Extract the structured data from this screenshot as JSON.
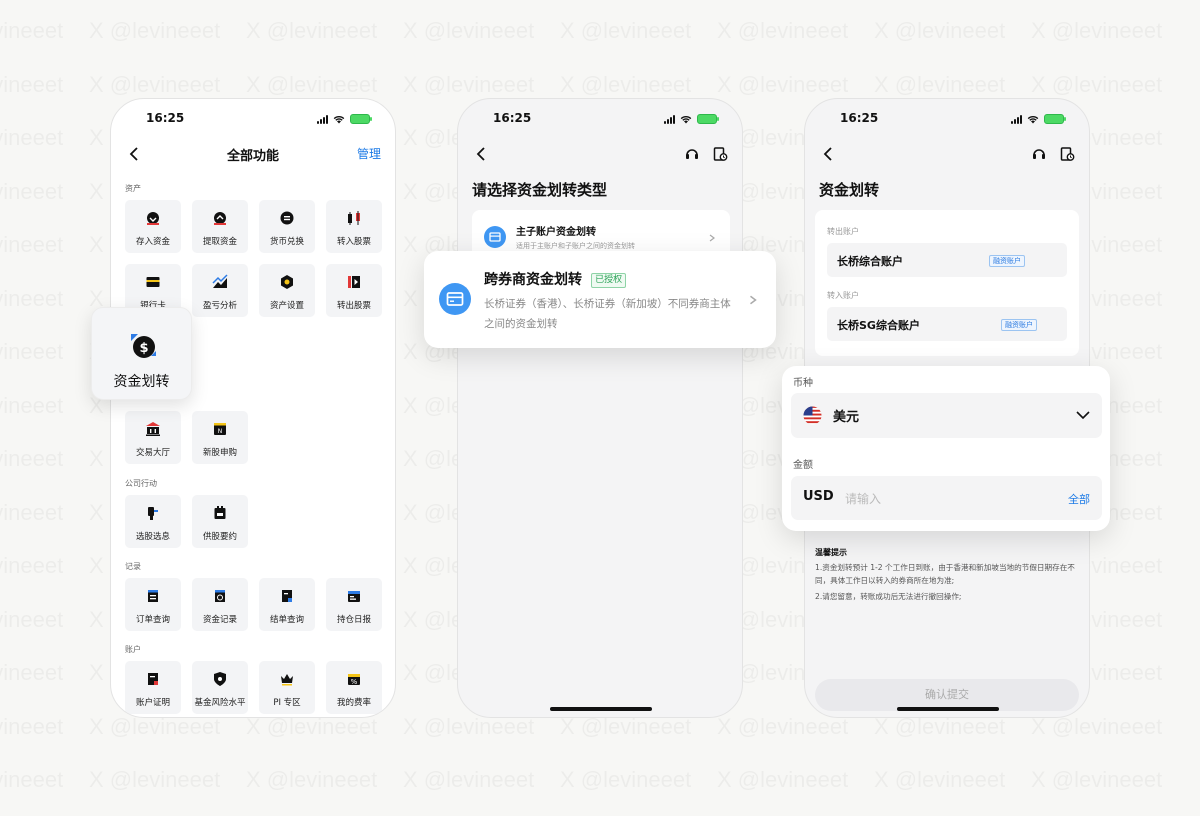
{
  "watermark": "X @levineeet",
  "status": {
    "time": "16:25"
  },
  "screen1": {
    "nav_title": "全部功能",
    "manage": "管理",
    "sections": {
      "assets": "资产",
      "corporate": "公司行动",
      "records": "记录",
      "account": "账户"
    },
    "assets_tiles": [
      {
        "label": "存入资金",
        "icon": "deposit-icon"
      },
      {
        "label": "提取资金",
        "icon": "withdraw-icon"
      },
      {
        "label": "货币兑换",
        "icon": "currency-exchange-icon"
      },
      {
        "label": "转入股票",
        "icon": "stock-in-icon"
      },
      {
        "label": "银行卡",
        "icon": "bank-card-icon"
      },
      {
        "label": "盈亏分析",
        "icon": "chart-icon"
      },
      {
        "label": "资产设置",
        "icon": "settings-icon"
      },
      {
        "label": "转出股票",
        "icon": "stock-out-icon"
      }
    ],
    "highlight_tile": {
      "label": "资金划转",
      "icon": "dollar-transfer-icon"
    },
    "trade_tiles": [
      {
        "label": "交易大厅",
        "icon": "bank-hall-icon"
      },
      {
        "label": "新股申购",
        "icon": "ipo-icon"
      }
    ],
    "corporate_tiles": [
      {
        "label": "选股选息",
        "icon": "option-icon"
      },
      {
        "label": "供股要约",
        "icon": "offer-icon"
      }
    ],
    "record_tiles": [
      {
        "label": "订单查询",
        "icon": "order-icon"
      },
      {
        "label": "资金记录",
        "icon": "fund-record-icon"
      },
      {
        "label": "结单查询",
        "icon": "statement-icon"
      },
      {
        "label": "持仓日报",
        "icon": "daily-report-icon"
      }
    ],
    "account_tiles": [
      {
        "label": "账户证明",
        "icon": "certificate-icon"
      },
      {
        "label": "基金风险水平",
        "icon": "risk-shield-icon"
      },
      {
        "label": "PI 专区",
        "icon": "crown-icon"
      },
      {
        "label": "我的费率",
        "icon": "rate-icon"
      }
    ]
  },
  "screen2": {
    "title": "请选择资金划转类型",
    "option1": {
      "title": "主子账户资金划转",
      "desc": "适用于主账户和子账户之间的资金划转"
    },
    "option2": {
      "title": "跨券商资金划转",
      "badge": "已授权",
      "desc": "长桥证券（香港）、长桥证券（新加坡）不同券商主体之间的资金划转"
    }
  },
  "screen3": {
    "title": "资金划转",
    "from_label": "转出账户",
    "from_account": "长桥综合账户",
    "from_tag": "融资账户",
    "to_label": "转入账户",
    "to_account": "长桥SG综合账户",
    "to_tag": "融资账户",
    "currency_label": "币种",
    "currency_value": "美元",
    "amount_label": "金额",
    "amount_currency": "USD",
    "amount_placeholder": "请输入",
    "all": "全部",
    "tips_title": "温馨提示",
    "tip1": "1.资金划转预计 1-2 个工作日到账，由于香港和新加坡当地的节假日期存在不同，具体工作日以转入的券商所在地为准;",
    "tip2": "2.请您留意，转账成功后无法进行撤回操作;",
    "submit": "确认提交"
  },
  "colors": {
    "accent": "#1c7ae6",
    "badge_green": "#2ea45a"
  }
}
